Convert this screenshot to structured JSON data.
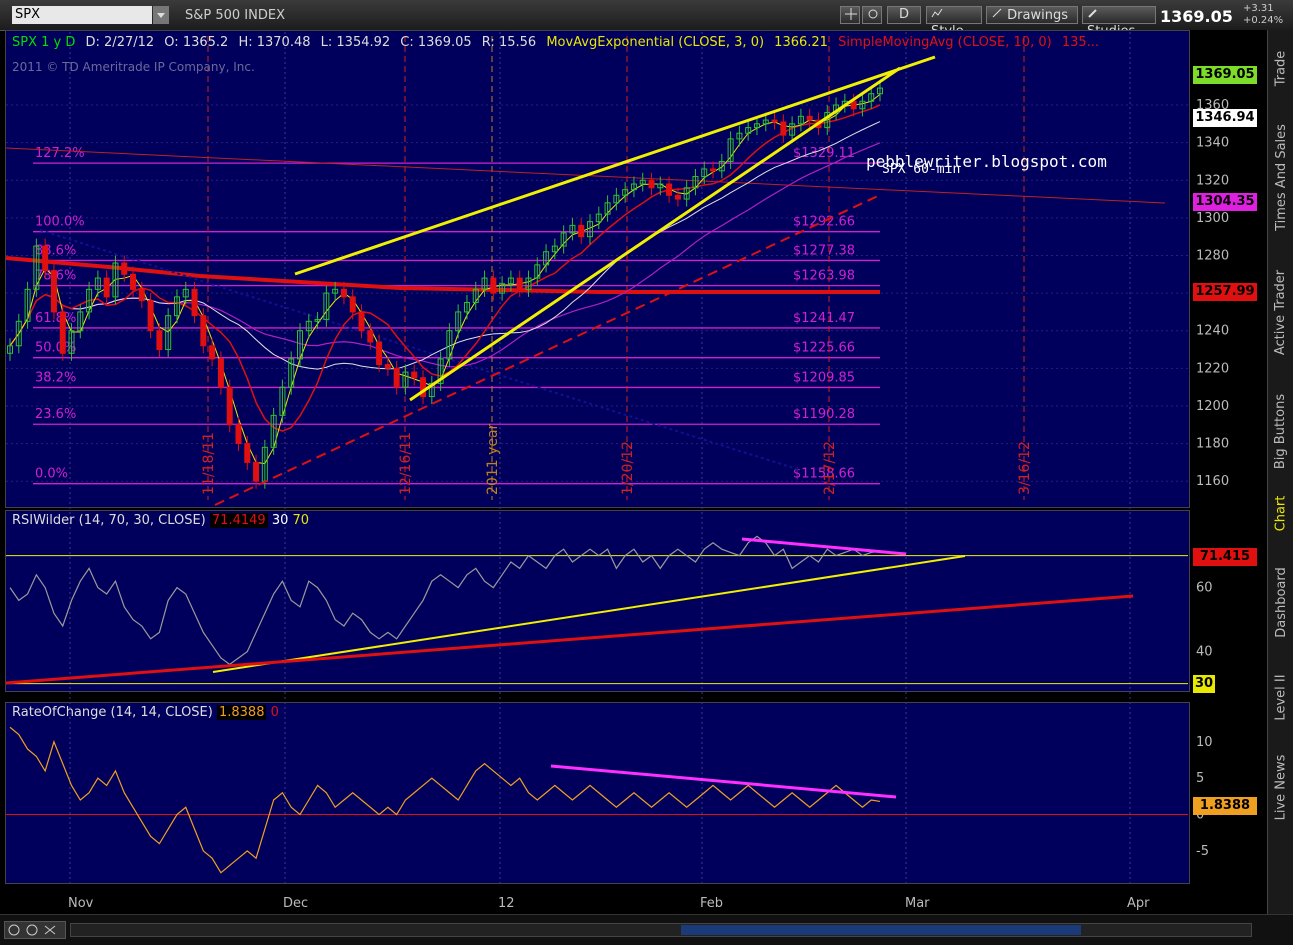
{
  "toolbar": {
    "symbol": "SPX",
    "name": "S&P 500 INDEX",
    "period_button": "D",
    "style_label": "Style",
    "drawings_label": "Drawings",
    "studies_label": "Studies",
    "last_price": "1369.05",
    "change": "+3.31",
    "change_pct": "+0.24%"
  },
  "header": {
    "symbol_period": "SPX 1 y D",
    "date": "D: 2/27/12",
    "open": "O: 1365.2",
    "high": "H: 1370.48",
    "low": "L: 1354.92",
    "close": "C: 1369.05",
    "range": "R: 15.56",
    "ema_label": "MovAvgExponential (CLOSE, 3, 0)",
    "ema_value": "1366.21",
    "sma_label": "SimpleMovingAvg (CLOSE, 10, 0)",
    "sma_value": "135..."
  },
  "copyright": "2011 © TD Ameritrade IP Company, Inc.",
  "watermark": "pebblewriter.blogspot.com",
  "watermark_sub": "SPX 60-min",
  "right_tabs": [
    "Trade",
    "Times And Sales",
    "Active Trader",
    "Big Buttons",
    "Chart",
    "Dashboard",
    "Level II",
    "Live News"
  ],
  "active_tab": "Chart",
  "x_labels": [
    "Nov",
    "Dec",
    "12",
    "Feb",
    "Mar",
    "Apr"
  ],
  "chart_data": [
    {
      "type": "candlestick",
      "title": "SPX 1 y D",
      "ylim": [
        1150,
        1385
      ],
      "y_ticks": [
        1160,
        1180,
        1200,
        1220,
        1240,
        1260,
        1280,
        1300,
        1320,
        1340,
        1360
      ],
      "price_tags": [
        {
          "value": "1369.05",
          "color": "#7ddc2a"
        },
        {
          "value": "1346.94",
          "color": "#ffffff"
        },
        {
          "value": "1304.35",
          "color": "#e020e0"
        },
        {
          "value": "1257.99",
          "color": "#e01010"
        }
      ],
      "fib_levels": [
        {
          "pct": "127.2%",
          "price": "$1329.11",
          "value": 1329.11
        },
        {
          "pct": "100.0%",
          "price": "$1292.66",
          "value": 1292.66
        },
        {
          "pct": "88.6%",
          "price": "$1277.38",
          "value": 1277.38
        },
        {
          "pct": "78.6%",
          "price": "$1263.98",
          "value": 1263.98
        },
        {
          "pct": "61.8%",
          "price": "$1241.47",
          "value": 1241.47
        },
        {
          "pct": "50.0%",
          "price": "$1225.66",
          "value": 1225.66
        },
        {
          "pct": "38.2%",
          "price": "$1209.85",
          "value": 1209.85
        },
        {
          "pct": "23.6%",
          "price": "$1190.28",
          "value": 1190.28
        },
        {
          "pct": "0.0%",
          "price": "$1158.66",
          "value": 1158.66
        }
      ],
      "vertical_dates": [
        "11/18/11",
        "12/16/11",
        "2011 year",
        "1/20/12",
        "2/17/12",
        "3/16/12"
      ],
      "closes": [
        1232,
        1245,
        1262,
        1285,
        1272,
        1250,
        1228,
        1240,
        1250,
        1262,
        1268,
        1258,
        1276,
        1270,
        1262,
        1256,
        1240,
        1230,
        1248,
        1258,
        1262,
        1248,
        1232,
        1225,
        1210,
        1190,
        1180,
        1170,
        1160,
        1178,
        1195,
        1210,
        1225,
        1240,
        1245,
        1246,
        1260,
        1262,
        1258,
        1250,
        1240,
        1234,
        1222,
        1220,
        1210,
        1218,
        1215,
        1205,
        1212,
        1225,
        1240,
        1250,
        1255,
        1262,
        1268,
        1260,
        1265,
        1268,
        1262,
        1268,
        1275,
        1282,
        1285,
        1292,
        1296,
        1290,
        1298,
        1302,
        1308,
        1312,
        1315,
        1318,
        1320,
        1316,
        1318,
        1312,
        1310,
        1316,
        1322,
        1326,
        1325,
        1330,
        1342,
        1345,
        1348,
        1350,
        1352,
        1351,
        1344,
        1350,
        1354,
        1352,
        1348,
        1356,
        1360,
        1362,
        1358,
        1362,
        1366,
        1369
      ]
    },
    {
      "type": "line",
      "title": "RSIWilder (14, 70, 30, CLOSE)",
      "value": "71.4149",
      "levels": [
        "30",
        "70"
      ],
      "ylim": [
        28,
        78
      ],
      "y_ticks": [
        40,
        60
      ],
      "tags": [
        {
          "value": "71.415",
          "color": "#e01010"
        },
        {
          "value": "30",
          "color": "#e8e800"
        }
      ],
      "values": [
        60,
        56,
        58,
        64,
        60,
        52,
        48,
        56,
        62,
        66,
        60,
        58,
        62,
        54,
        50,
        48,
        44,
        46,
        56,
        60,
        58,
        52,
        46,
        42,
        38,
        36,
        38,
        40,
        46,
        52,
        58,
        62,
        56,
        54,
        62,
        60,
        56,
        50,
        48,
        52,
        50,
        46,
        44,
        46,
        44,
        48,
        52,
        56,
        62,
        64,
        62,
        60,
        64,
        66,
        62,
        60,
        64,
        68,
        66,
        70,
        68,
        66,
        70,
        72,
        68,
        70,
        72,
        70,
        72,
        66,
        70,
        72,
        68,
        70,
        66,
        70,
        72,
        70,
        68,
        72,
        74,
        72,
        71,
        70,
        74,
        76,
        74,
        70,
        72,
        66,
        68,
        70,
        68,
        72,
        70,
        71,
        72,
        70,
        71,
        71.4
      ]
    },
    {
      "type": "line",
      "title": "RateOfChange (14, 14, CLOSE)",
      "value": "1.8388",
      "zero_label": "0",
      "ylim": [
        -9,
        13
      ],
      "y_ticks": [
        -5,
        0,
        5,
        10
      ],
      "tag": {
        "value": "1.8388",
        "color": "#f0a020"
      },
      "values": [
        12,
        11,
        9,
        8,
        6,
        10,
        7,
        4,
        2,
        3,
        5,
        4,
        6,
        3,
        1,
        -1,
        -3,
        -4,
        -2,
        0,
        1,
        -2,
        -5,
        -6,
        -8,
        -7,
        -6,
        -5,
        -6,
        -2,
        2,
        3,
        1,
        0,
        2,
        4,
        3,
        1,
        2,
        3,
        2,
        1,
        0,
        1,
        0,
        2,
        3,
        4,
        5,
        4,
        3,
        2,
        4,
        6,
        7,
        6,
        5,
        4,
        5,
        3,
        2,
        3,
        4,
        3,
        2,
        3,
        4,
        3,
        2,
        1,
        2,
        3,
        2,
        1,
        2,
        3,
        2,
        1,
        2,
        3,
        4,
        3,
        2,
        3,
        4,
        3,
        2,
        1,
        2,
        3,
        2,
        1,
        2,
        3,
        4,
        3,
        2,
        1,
        2,
        1.8
      ]
    }
  ]
}
